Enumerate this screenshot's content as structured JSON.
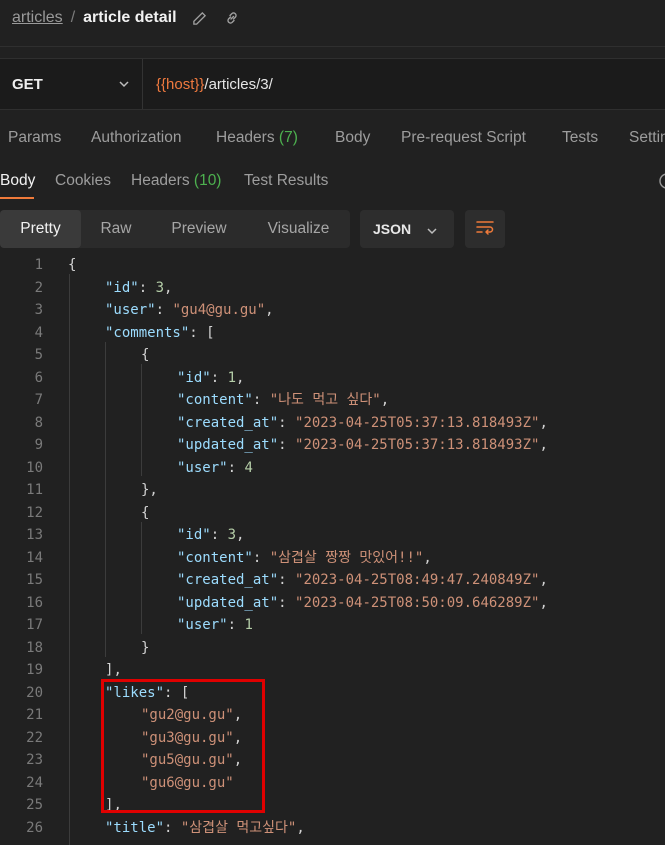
{
  "breadcrumb": {
    "parent": "articles",
    "separator": "/",
    "current": "article detail"
  },
  "request": {
    "method": "GET",
    "url_variable": "{{host}}",
    "url_path": "/articles/3/"
  },
  "request_tabs": {
    "params": "Params",
    "authorization": "Authorization",
    "headers": "Headers",
    "headers_count": "(7)",
    "body": "Body",
    "pre_request": "Pre-request Script",
    "tests": "Tests",
    "settings": "Settings"
  },
  "response_tabs": {
    "body": "Body",
    "cookies": "Cookies",
    "headers": "Headers",
    "headers_count": "(10)",
    "test_results": "Test Results"
  },
  "view_modes": {
    "pretty": "Pretty",
    "raw": "Raw",
    "preview": "Preview",
    "visualize": "Visualize"
  },
  "format": "JSON",
  "line_numbers": [
    "1",
    "2",
    "3",
    "4",
    "5",
    "6",
    "7",
    "8",
    "9",
    "10",
    "11",
    "12",
    "13",
    "14",
    "15",
    "16",
    "17",
    "18",
    "19",
    "20",
    "21",
    "22",
    "23",
    "24",
    "25",
    "26"
  ],
  "code": {
    "open_brace": "{",
    "close_bracket": "]",
    "id_key": "\"id\"",
    "id_val": "3",
    "user_key": "\"user\"",
    "user_val": "\"gu4@gu.gu\"",
    "comments_key": "\"comments\"",
    "c1": {
      "id_key": "\"id\"",
      "id_val": "1",
      "content_key": "\"content\"",
      "content_val": "\"나도 먹고 싶다\"",
      "created_key": "\"created_at\"",
      "created_val": "\"2023-04-25T05:37:13.818493Z\"",
      "updated_key": "\"updated_at\"",
      "updated_val": "\"2023-04-25T05:37:13.818493Z\"",
      "user_key": "\"user\"",
      "user_val": "4"
    },
    "c2": {
      "id_key": "\"id\"",
      "id_val": "3",
      "content_key": "\"content\"",
      "content_val": "\"삼겹살 짱짱 맛있어!!\"",
      "created_key": "\"created_at\"",
      "created_val": "\"2023-04-25T08:49:47.240849Z\"",
      "updated_key": "\"updated_at\"",
      "updated_val": "\"2023-04-25T08:50:09.646289Z\"",
      "user_key": "\"user\"",
      "user_val": "1"
    },
    "likes_key": "\"likes\"",
    "likes": [
      "\"gu2@gu.gu\"",
      "\"gu3@gu.gu\"",
      "\"gu5@gu.gu\"",
      "\"gu6@gu.gu\""
    ],
    "title_key": "\"title\"",
    "title_val": "\"삼겹살 먹고싶다\""
  },
  "colors": {
    "accent": "#ef7a3a",
    "highlight_box": "#e00000",
    "key": "#9cdcfe",
    "string": "#ce9178",
    "number": "#b5cea8"
  }
}
